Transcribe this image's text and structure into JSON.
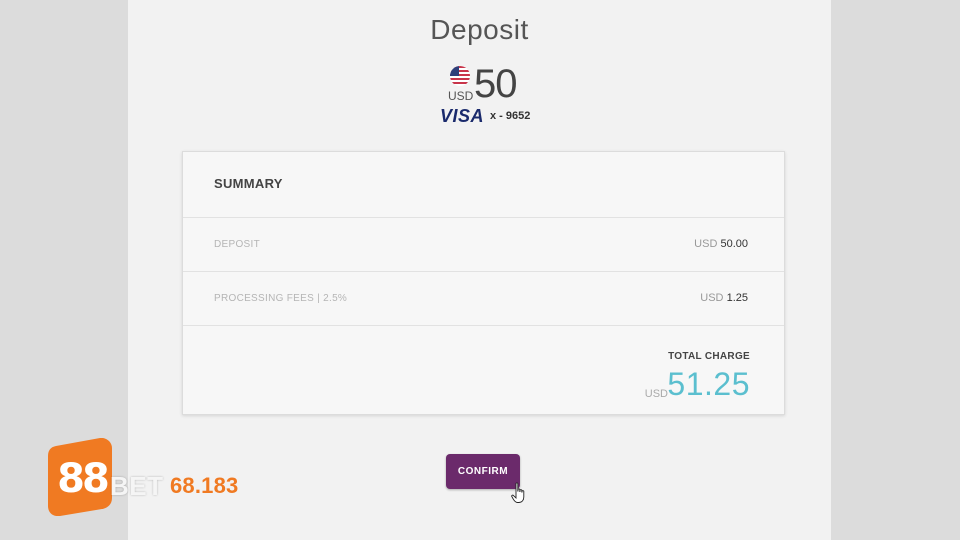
{
  "header": {
    "title": "Deposit"
  },
  "deposit": {
    "currency": "USD",
    "amount": "50",
    "card_brand": "VISA",
    "card_number": "x - 9652",
    "flag_icon": "us-flag-icon"
  },
  "summary": {
    "heading": "SUMMARY",
    "rows": [
      {
        "label": "DEPOSIT",
        "currency": "USD",
        "value": "50.00"
      },
      {
        "label": "PROCESSING FEES | 2.5%",
        "currency": "USD",
        "value": "1.25"
      }
    ],
    "total_label": "TOTAL CHARGE",
    "total_currency": "USD",
    "total_value": "51.25"
  },
  "actions": {
    "confirm_label": "CONFIRM"
  },
  "watermark": {
    "badge": "88",
    "bet": "BET",
    "number": "68.183"
  },
  "colors": {
    "total_accent": "#5bbfcf",
    "confirm_bg": "#6b2a6b",
    "logo_orange": "#f07a22"
  }
}
